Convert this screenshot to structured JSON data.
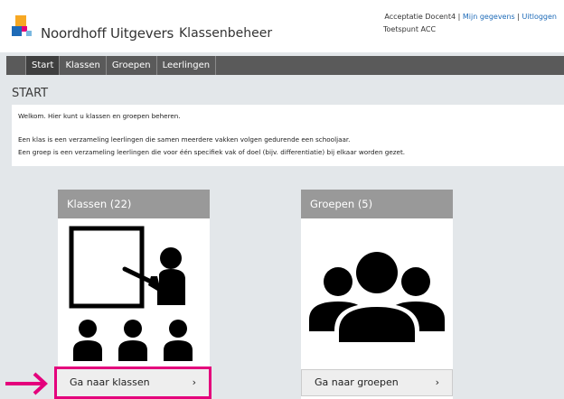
{
  "header": {
    "brand": "Noordhoff Uitgevers",
    "app_title": "Klassenbeheer",
    "user_name": "Acceptatie Docent4",
    "separator": "|",
    "my_data_link": "Mijn gegevens",
    "logout_link": "Uitloggen",
    "subtitle": "Toetspunt ACC"
  },
  "nav": {
    "items": [
      "Start",
      "Klassen",
      "Groepen",
      "Leerlingen"
    ]
  },
  "page": {
    "title": "START",
    "intro": [
      "Welkom. Hier kunt u klassen en groepen beheren.",
      "Een klas is een verzameling leerlingen die samen meerdere vakken volgen gedurende een schooljaar.",
      "Een groep is een verzameling leerlingen die voor één specifiek vak of doel (bijv. differentiatie) bij elkaar worden gezet."
    ]
  },
  "cards": {
    "klassen": {
      "title": "Klassen (22)",
      "button": "Ga naar klassen",
      "chevron": "›"
    },
    "groepen": {
      "title": "Groepen (5)",
      "button": "Ga naar groepen",
      "chevron": "›"
    }
  },
  "colors": {
    "accent_highlight": "#e4007c",
    "nav_bg": "#5a5a5a",
    "card_header": "#999999",
    "page_bg": "#e3e7ea"
  },
  "icons": [
    "noordhoff-logo-icon",
    "classroom-icon",
    "group-icon",
    "arrow-right-icon"
  ]
}
